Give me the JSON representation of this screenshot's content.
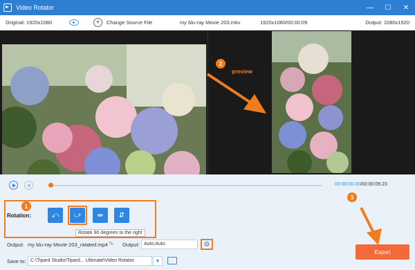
{
  "titlebar": {
    "title": "Video Rotator"
  },
  "infobar": {
    "original": "Original: 1920x1080",
    "change_source": "Change Source File",
    "file_name": "my blu-ray Movie 203.mkv",
    "resolution_time": "1920x1080/00:00:09",
    "output": "Output: 1080x1920"
  },
  "annotations": {
    "badge1": "1",
    "badge2": "2",
    "badge3": "3",
    "preview_label": "preview"
  },
  "player": {
    "current_time": "00:00:00.00",
    "total_time": "/00:00:09.23",
    "progress": 0.0
  },
  "rotation": {
    "label": "Rotation:",
    "tooltip": "Rotate 90 degrees to the right"
  },
  "output_row": {
    "output_label": "Output:",
    "output_file": "my blu-ray Movie 203_ratated.mp4",
    "output_format_label": "Output:",
    "output_format_value": "Auto;Auto"
  },
  "save_row": {
    "label": "Save to:",
    "path": "C:\\Tipard Studio\\Tipard... Ultimate\\Video Rotator"
  },
  "export": {
    "label": "Export"
  },
  "colors": {
    "accent": "#2e86e4",
    "highlight": "#f07c1b",
    "export": "#f26a3a"
  }
}
